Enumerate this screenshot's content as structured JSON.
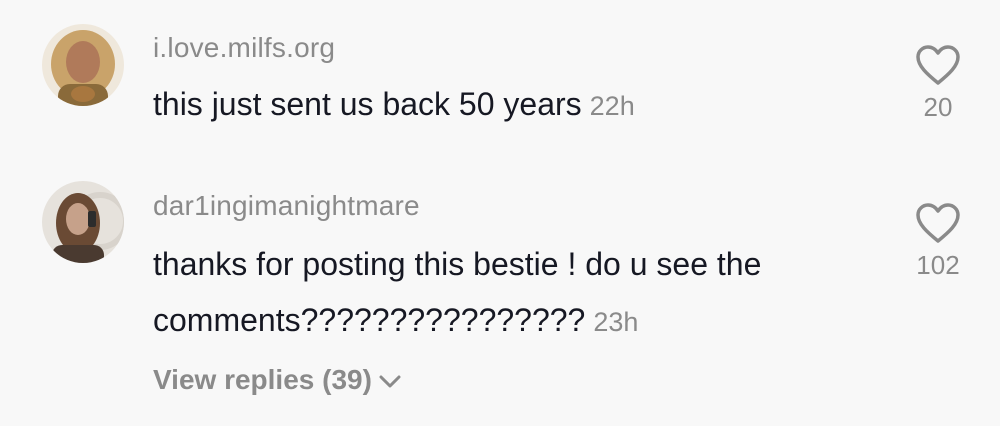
{
  "comments": [
    {
      "username": "i.love.milfs.org",
      "text": "this just sent us back 50 years",
      "time": "22h",
      "likes": "20",
      "avatar_icon": "user-avatar-photo"
    },
    {
      "username": "dar1ingimanightmare",
      "text": "thanks for posting this bestie ! do u see the comments????????????????",
      "time": "23h",
      "likes": "102",
      "avatar_icon": "user-avatar-photo"
    }
  ],
  "view_replies": {
    "label": "View replies (39)",
    "icon": "chevron-down-icon"
  },
  "colors": {
    "background": "#f8f8f8",
    "text": "#161823",
    "muted": "#8a8a8a"
  }
}
